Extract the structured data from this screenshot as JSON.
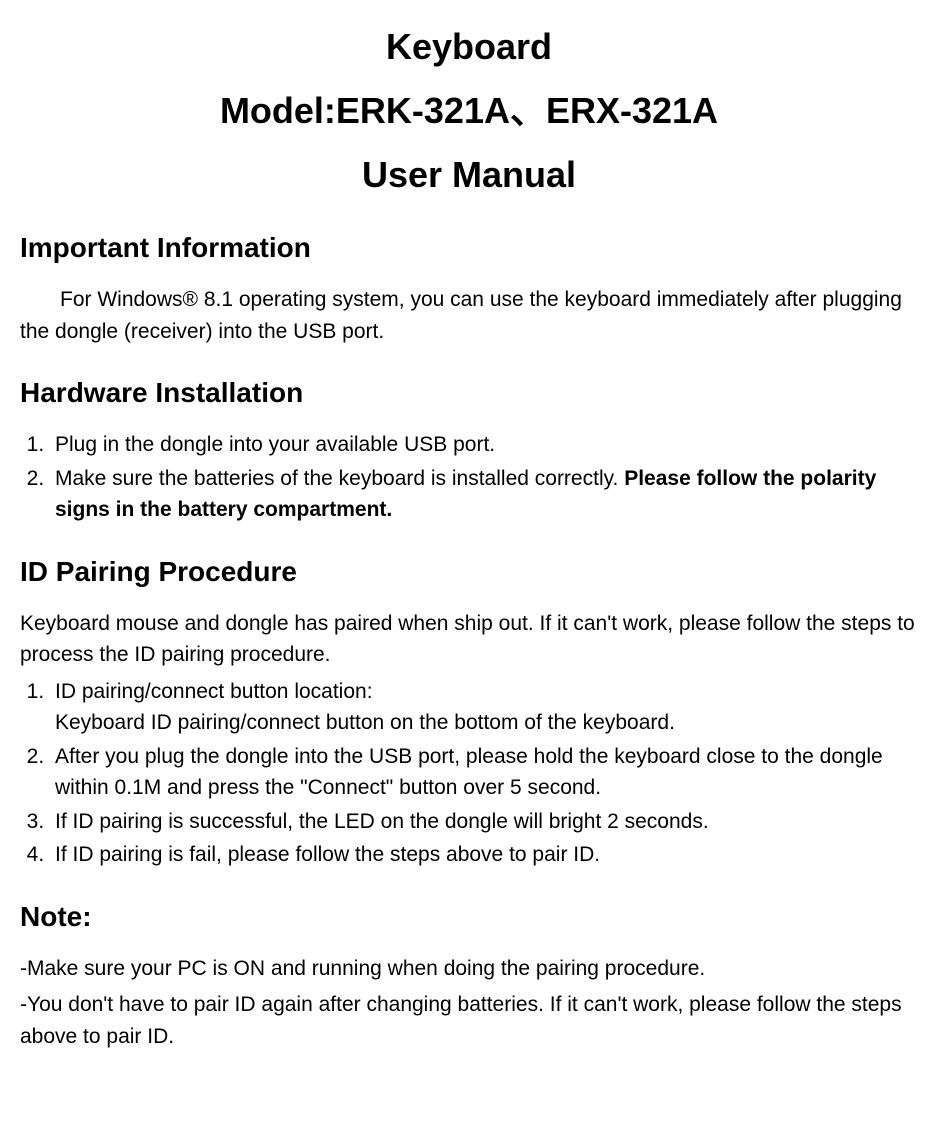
{
  "title": {
    "line1": "Keyboard",
    "line2": "Model:ERK-321A、ERX-321A",
    "line3": "User Manual"
  },
  "sections": {
    "important": {
      "heading": "Important Information",
      "text": "For Windows® 8.1 operating system, you can use the keyboard immediately after plugging the dongle (receiver) into the USB port."
    },
    "hardware": {
      "heading": "Hardware Installation",
      "items": [
        {
          "text": "Plug in the dongle into your available USB port."
        },
        {
          "text": "Make sure the batteries of the keyboard is installed correctly. ",
          "bold": "Please follow the polarity signs in the battery compartment."
        }
      ]
    },
    "pairing": {
      "heading": "ID Pairing Procedure",
      "intro": "Keyboard mouse and dongle has paired when ship out. If it can't work, please follow the steps to process the ID pairing procedure.",
      "items": [
        {
          "text": "ID pairing/connect button location:",
          "sub": "Keyboard ID pairing/connect button on the bottom of the keyboard."
        },
        {
          "text": "After you plug the dongle into the USB port, please hold the keyboard close to the dongle within 0.1M and press the \"Connect\" button over 5 second."
        },
        {
          "text": "If ID pairing is successful, the LED on the dongle will bright 2 seconds."
        },
        {
          "text": "If ID pairing is fail, please follow the steps above to pair ID."
        }
      ]
    },
    "note": {
      "heading": "Note:",
      "lines": [
        "-Make sure your PC is ON and running when doing the pairing procedure.",
        "-You don't have to pair ID again after changing batteries. If it can't work, please follow the steps above to pair ID."
      ]
    }
  }
}
